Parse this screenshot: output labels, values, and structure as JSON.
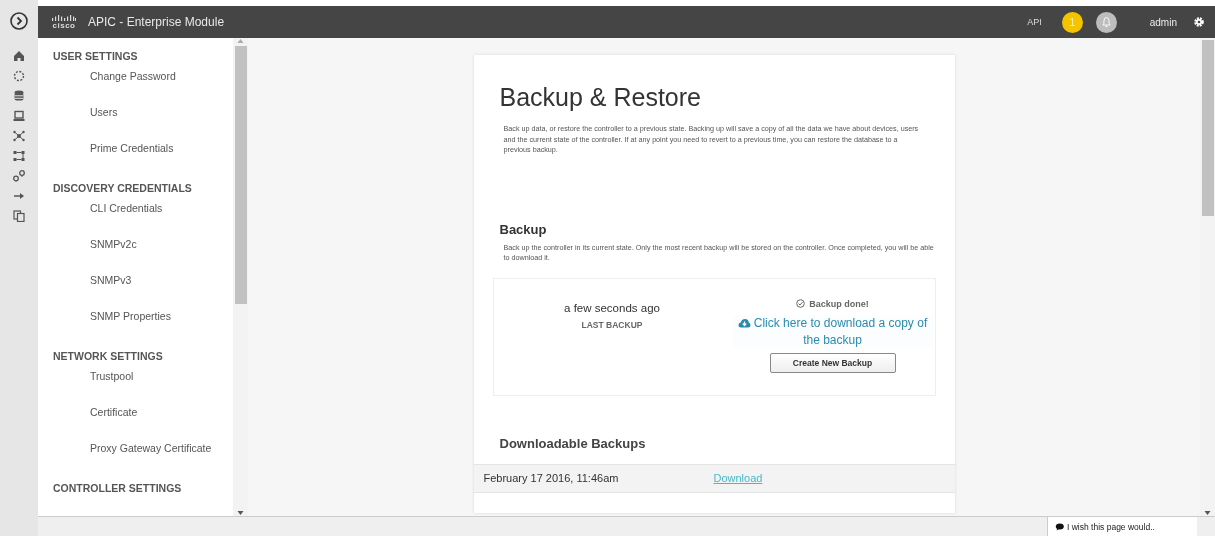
{
  "app": {
    "logo_text": "cisco",
    "title": "APIC - Enterprise Module"
  },
  "topbar": {
    "api": "API",
    "notification_count": "1",
    "user": "admin"
  },
  "sidebar": {
    "sections": [
      {
        "heading": "USER SETTINGS",
        "items": [
          {
            "label": "Change Password"
          },
          {
            "label": "Users"
          },
          {
            "label": "Prime Credentials"
          }
        ]
      },
      {
        "heading": "DISCOVERY CREDENTIALS",
        "items": [
          {
            "label": "CLI Credentials"
          },
          {
            "label": "SNMPv2c"
          },
          {
            "label": "SNMPv3"
          },
          {
            "label": "SNMP Properties"
          }
        ]
      },
      {
        "heading": "NETWORK SETTINGS",
        "items": [
          {
            "label": "Trustpool"
          },
          {
            "label": "Certificate"
          },
          {
            "label": "Proxy Gateway Certificate"
          }
        ]
      },
      {
        "heading": "CONTROLLER SETTINGS"
      }
    ]
  },
  "page": {
    "title": "Backup & Restore",
    "description": "Back up data, or restore the controller to a previous state. Backing up will save a copy of all the data we have about devices, users and the current state of the controller. If at any point you need to revert to a previous time, you can restore the database to a previous backup.",
    "backup": {
      "heading": "Backup",
      "description": "Back up the controller in its current state. Only the most recent backup will be stored on the controller. Once completed, you will be able to download it.",
      "last_backup_time": "a few seconds ago",
      "last_backup_label": "LAST BACKUP",
      "status": "Backup done!",
      "download_link": "Click here to download a copy of the backup",
      "create_button": "Create New Backup"
    },
    "downloadable": {
      "heading": "Downloadable Backups",
      "rows": [
        {
          "date": "February 17 2016, 11:46am",
          "action": "Download"
        }
      ]
    }
  },
  "feedback": {
    "label": "I wish this page would.."
  }
}
